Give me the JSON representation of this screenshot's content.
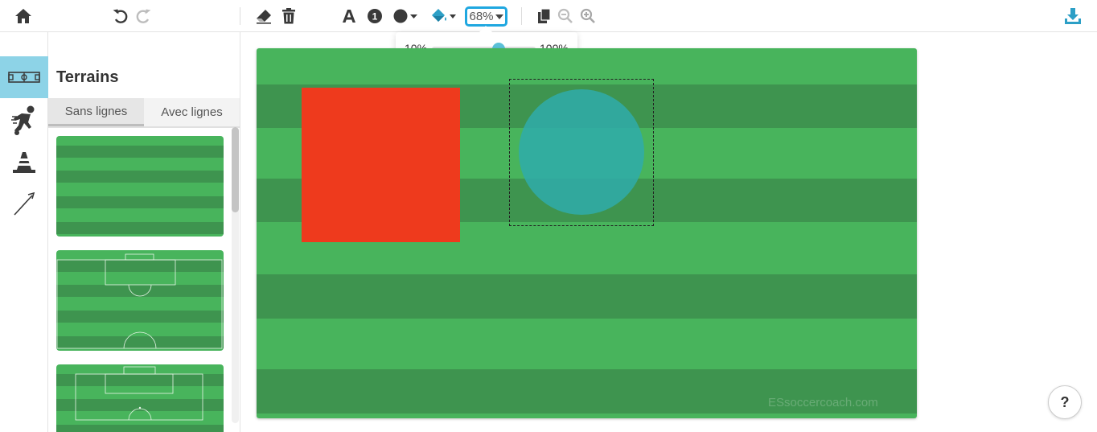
{
  "toolbar": {
    "icons": [
      "home-icon",
      "undo-icon",
      "redo-icon",
      "eraser-icon",
      "trash-icon",
      "text-icon",
      "number-icon",
      "shape-icon",
      "fill-color-icon",
      "copy-icon",
      "zoom-out-icon",
      "zoom-in-icon",
      "download-icon"
    ],
    "number_badge": "1",
    "opacity_value": "68%",
    "accent_color": "#1fa7e0"
  },
  "opacity_popover": {
    "min_label": "10%",
    "max_label": "100%",
    "value_fraction": 0.68
  },
  "sidebar": {
    "rail_items": [
      {
        "name": "terrains",
        "icon": "field-icon",
        "active": true
      },
      {
        "name": "players",
        "icon": "player-icon",
        "active": false
      },
      {
        "name": "equipment",
        "icon": "cone-icon",
        "active": false
      },
      {
        "name": "lines",
        "icon": "arrow-line-icon",
        "active": false
      }
    ],
    "active_color": "#8dd3e7"
  },
  "panel": {
    "title": "Terrains",
    "tabs": [
      {
        "label": "Sans lignes",
        "active": true
      },
      {
        "label": "Avec lignes",
        "active": false
      }
    ]
  },
  "canvas": {
    "watermark": "ESsoccercoach.com",
    "stripe_light": "#48b45c",
    "stripe_dark": "#3e944f",
    "rect_color": "#ee3a1d",
    "circle_color": "#2fabaa"
  },
  "help": {
    "label": "?"
  }
}
